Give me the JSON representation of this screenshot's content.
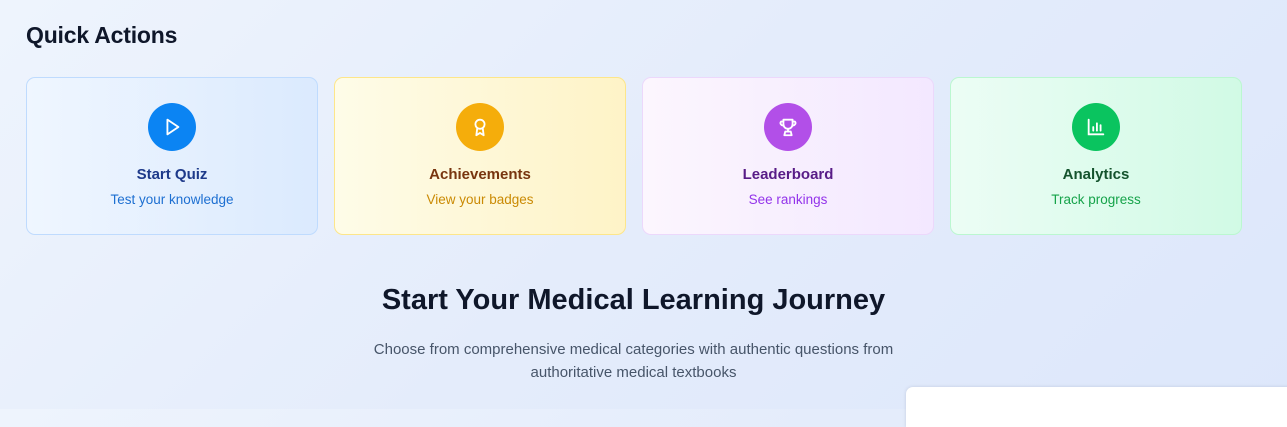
{
  "quick_actions": {
    "title": "Quick Actions",
    "cards": [
      {
        "title": "Start Quiz",
        "subtitle": "Test your knowledge",
        "icon": "play-icon",
        "accent": "#0b84f3"
      },
      {
        "title": "Achievements",
        "subtitle": "View your badges",
        "icon": "award-icon",
        "accent": "#f5ad0b"
      },
      {
        "title": "Leaderboard",
        "subtitle": "See rankings",
        "icon": "trophy-icon",
        "accent": "#b24fe8"
      },
      {
        "title": "Analytics",
        "subtitle": "Track progress",
        "icon": "bar-chart-icon",
        "accent": "#0ac45f"
      }
    ]
  },
  "hero": {
    "title": "Start Your Medical Learning Journey",
    "subtitle": "Choose from comprehensive medical categories with authentic questions from authoritative medical textbooks"
  }
}
